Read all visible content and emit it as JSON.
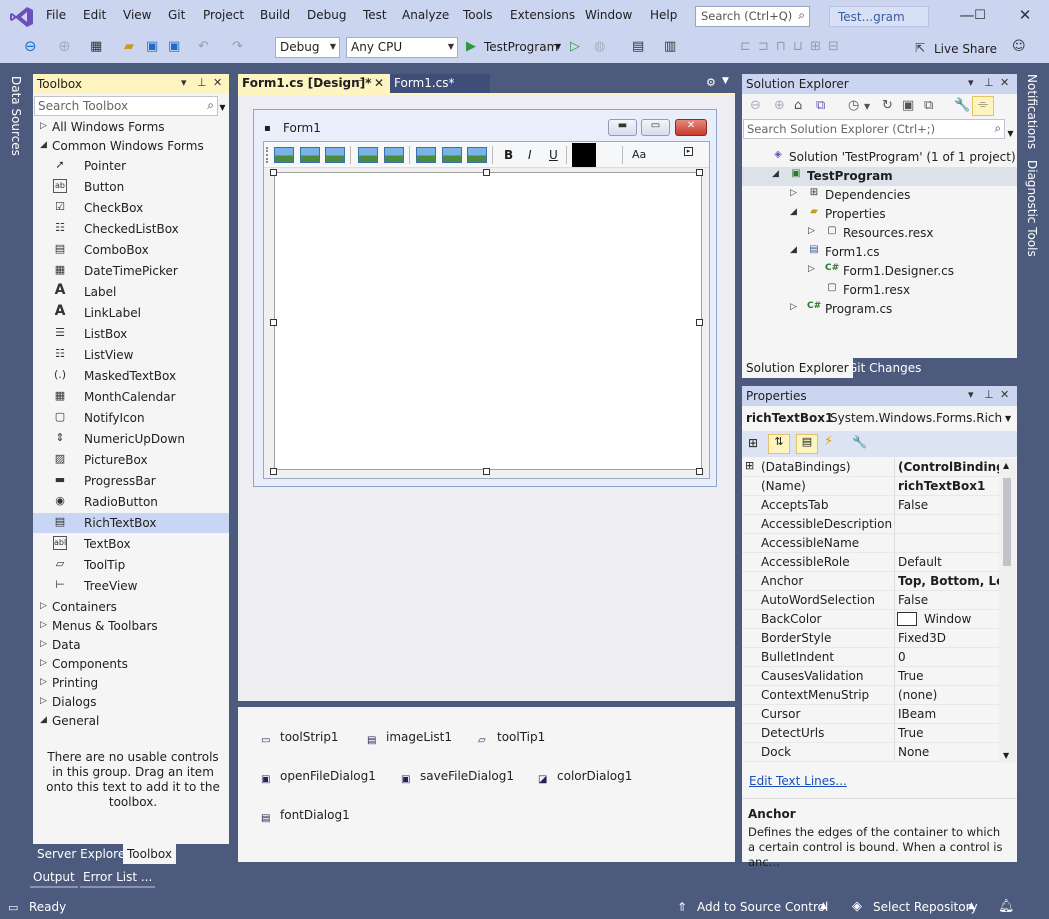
{
  "titlebar": {
    "menus": [
      "File",
      "Edit",
      "View",
      "Git",
      "Project",
      "Build",
      "Debug",
      "Test",
      "Analyze",
      "Tools",
      "Extensions",
      "Window",
      "Help"
    ],
    "search_placeholder": "Search (Ctrl+Q)",
    "window_title": "Test...gram"
  },
  "toolbar": {
    "config": "Debug",
    "platform": "Any CPU",
    "start_target": "TestProgram",
    "live_share": "Live Share"
  },
  "sidebars": {
    "left_label": "Data Sources",
    "right_labels": [
      "Notifications",
      "Diagnostic Tools"
    ]
  },
  "toolbox": {
    "title": "Toolbox",
    "search_placeholder": "Search Toolbox",
    "categories_top": [
      "All Windows Forms",
      "Common Windows Forms"
    ],
    "items": [
      {
        "label": "Pointer",
        "icon": "pointer-icon"
      },
      {
        "label": "Button",
        "icon": "button-icon"
      },
      {
        "label": "CheckBox",
        "icon": "checkbox-icon"
      },
      {
        "label": "CheckedListBox",
        "icon": "checkedlistbox-icon"
      },
      {
        "label": "ComboBox",
        "icon": "combobox-icon"
      },
      {
        "label": "DateTimePicker",
        "icon": "datetimepicker-icon"
      },
      {
        "label": "Label",
        "icon": "label-icon"
      },
      {
        "label": "LinkLabel",
        "icon": "linklabel-icon"
      },
      {
        "label": "ListBox",
        "icon": "listbox-icon"
      },
      {
        "label": "ListView",
        "icon": "listview-icon"
      },
      {
        "label": "MaskedTextBox",
        "icon": "maskedtextbox-icon"
      },
      {
        "label": "MonthCalendar",
        "icon": "monthcalendar-icon"
      },
      {
        "label": "NotifyIcon",
        "icon": "notifyicon-icon"
      },
      {
        "label": "NumericUpDown",
        "icon": "numericupdown-icon"
      },
      {
        "label": "PictureBox",
        "icon": "picturebox-icon"
      },
      {
        "label": "ProgressBar",
        "icon": "progressbar-icon"
      },
      {
        "label": "RadioButton",
        "icon": "radiobutton-icon"
      },
      {
        "label": "RichTextBox",
        "icon": "richtextbox-icon"
      },
      {
        "label": "TextBox",
        "icon": "textbox-icon"
      },
      {
        "label": "ToolTip",
        "icon": "tooltip-icon"
      },
      {
        "label": "TreeView",
        "icon": "treeview-icon"
      }
    ],
    "selected_item": "RichTextBox",
    "categories_bottom": [
      "Containers",
      "Menus & Toolbars",
      "Data",
      "Components",
      "Printing",
      "Dialogs",
      "General"
    ],
    "empty_message": "There are no usable controls in this group. Drag an item onto this text to add it to the toolbox.",
    "bottom_tabs": [
      "Server Explorer",
      "Toolbox"
    ]
  },
  "output_tabs": [
    "Output",
    "Error List ..."
  ],
  "documents": {
    "tabs": [
      "Form1.cs [Design]*",
      "Form1.cs*"
    ],
    "form_title": "Form1",
    "toolstrip_text_buttons": [
      "B",
      "I",
      "U",
      "Aa"
    ],
    "tray_components": [
      "toolStrip1",
      "imageList1",
      "toolTip1",
      "openFileDialog1",
      "saveFileDialog1",
      "colorDialog1",
      "fontDialog1"
    ]
  },
  "solution_explorer": {
    "title": "Solution Explorer",
    "search_placeholder": "Search Solution Explorer (Ctrl+;)",
    "tree": [
      {
        "label": "Solution 'TestProgram' (1 of 1 project)"
      },
      {
        "label": "TestProgram"
      },
      {
        "label": "Dependencies"
      },
      {
        "label": "Properties"
      },
      {
        "label": "Resources.resx"
      },
      {
        "label": "Form1.cs"
      },
      {
        "label": "Form1.Designer.cs"
      },
      {
        "label": "Form1.resx"
      },
      {
        "label": "Program.cs"
      }
    ],
    "tabs": [
      "Solution Explorer",
      "Git Changes"
    ]
  },
  "properties": {
    "title": "Properties",
    "object_name": "richTextBox1",
    "object_type": "System.Windows.Forms.RichText",
    "rows": [
      {
        "name": "(DataBindings)",
        "value": "(ControlBindings)"
      },
      {
        "name": "(Name)",
        "value": "richTextBox1"
      },
      {
        "name": "AcceptsTab",
        "value": "False"
      },
      {
        "name": "AccessibleDescription",
        "value": ""
      },
      {
        "name": "AccessibleName",
        "value": ""
      },
      {
        "name": "AccessibleRole",
        "value": "Default"
      },
      {
        "name": "Anchor",
        "value": "Top, Bottom, Left,"
      },
      {
        "name": "AutoWordSelection",
        "value": "False"
      },
      {
        "name": "BackColor",
        "value": "Window"
      },
      {
        "name": "BorderStyle",
        "value": "Fixed3D"
      },
      {
        "name": "BulletIndent",
        "value": "0"
      },
      {
        "name": "CausesValidation",
        "value": "True"
      },
      {
        "name": "ContextMenuStrip",
        "value": "(none)"
      },
      {
        "name": "Cursor",
        "value": "IBeam"
      },
      {
        "name": "DetectUrls",
        "value": "True"
      },
      {
        "name": "Dock",
        "value": "None"
      }
    ],
    "link": "Edit Text Lines...",
    "desc_title": "Anchor",
    "desc_text": "Defines the edges of the container to which a certain control is bound. When a control is anc..."
  },
  "status": {
    "ready": "Ready",
    "add_source_control": "Add to Source Control",
    "select_repo": "Select Repository"
  },
  "colors": {
    "accent": "#6b4fbb",
    "frame": "#4c5a7e",
    "panel_header": "#ccd5f0",
    "selection": "#c9d5f5"
  }
}
